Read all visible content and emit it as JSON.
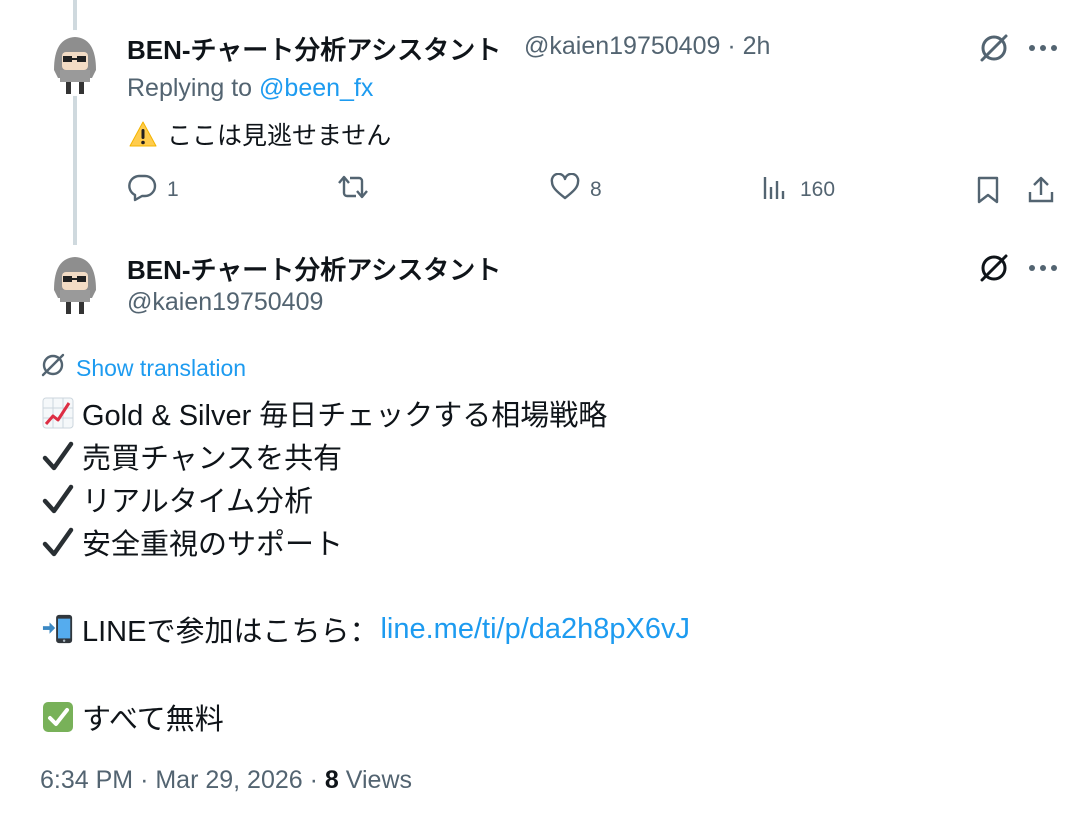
{
  "reply_tweet": {
    "display_name": "BEN-チャート分析アシスタント",
    "handle": "@kaien19750409",
    "separator": "·",
    "time_ago": "2h",
    "replying_prefix": "Replying to",
    "replying_to": "@been_fx",
    "text": "ここは見逃せません",
    "replies": "1",
    "likes": "8",
    "views": "160"
  },
  "main_tweet": {
    "display_name": "BEN-チャート分析アシスタント",
    "handle": "@kaien19750409",
    "show_translation": "Show translation",
    "lines": {
      "line1": "Gold & Silver 毎日チェックする相場戦略",
      "line2": "売買チャンスを共有",
      "line3": "リアルタイム分析",
      "line4": "安全重視のサポート",
      "line5_text": "LINEで参加はこちら：",
      "line5_link": "line.me/ti/p/da2h8pX6vJ",
      "line6": "すべて無料"
    },
    "time": "6:34 PM",
    "date": "Mar 29, 2026",
    "views_count": "8",
    "views_label": "Views"
  },
  "colors": {
    "link": "#1d9bf0",
    "muted": "#536471",
    "text": "#0f1419",
    "thread_line": "#cfd9de",
    "check_green": "#78b159"
  },
  "icons": [
    "grok-icon",
    "more-icon",
    "reply-icon",
    "retweet-icon",
    "like-icon",
    "views-icon",
    "bookmark-icon",
    "share-icon",
    "warning-icon",
    "chart-emoji-icon",
    "checkmark-icon",
    "phone-arrow-icon",
    "check-box-icon",
    "translate-icon"
  ]
}
